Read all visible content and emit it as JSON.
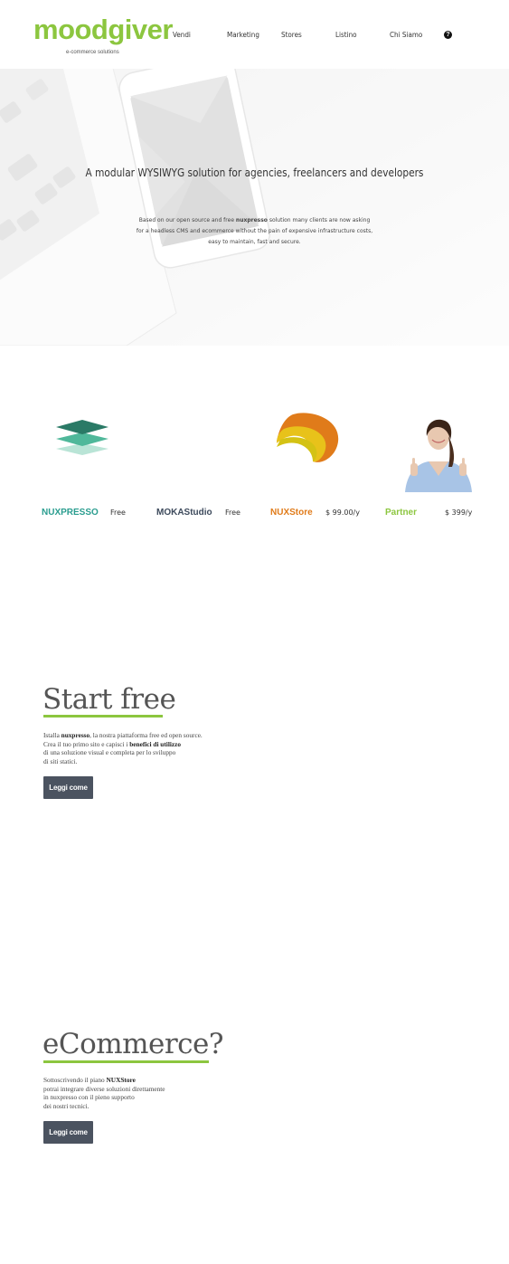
{
  "header": {
    "logo": "moodgiver",
    "tagline": "e-commerce solutions",
    "nav": [
      "Vendi",
      "Marketing",
      "Stores",
      "Listino",
      "Chi Siamo"
    ],
    "help_icon": "?"
  },
  "hero": {
    "title": "A modular WYSIWYG solution for agencies, freelancers and developers",
    "desc_1_pre": "Based on our open source and free ",
    "desc_1_link": "nuxpresso",
    "desc_1_post": " solution many clients are now asking",
    "desc_2": "for a headless CMS and ecommerce without the pain of expensive infrastructure costs,",
    "desc_3": "easy to maintain, fast and secure."
  },
  "products": [
    {
      "name": "NUXPRESSO",
      "price": "Free",
      "color": "#2a9d8f",
      "icon": "layers-icon"
    },
    {
      "name": "MOKAStudio",
      "price": "Free",
      "color": "#3d4a5c",
      "icon": ""
    },
    {
      "name": "NUXStore",
      "price": "$ 99.00/y",
      "color": "#e07b1a",
      "icon": "boomerang-icon"
    },
    {
      "name": "Partner",
      "price": "$ 399/y",
      "color": "#8cc63f",
      "icon": "partner-photo"
    }
  ],
  "start_free": {
    "title": "Start free",
    "l1_a": "Istalla ",
    "l1_b": "nuxpresso",
    "l1_c": ", la nostra piattaforma free ed open source.",
    "l2_a": "Crea il tuo primo sito e capisci i ",
    "l2_b": "benefici di utilizzo",
    "l3": "di una soluzione visual e completa per lo sviluppo",
    "l4": "di siti statici.",
    "button": "Leggi come"
  },
  "ecommerce": {
    "title": "eCommerce?",
    "l1_a": "Sottoscrivendo il piano ",
    "l1_b": "NUXStore",
    "l2": "potrai integrare diverse soluzioni direttamente",
    "l3": "in nuxpresso con il pieno supporto",
    "l4": "dei nostri tecnici.",
    "button": "Leggi come"
  },
  "colors": {
    "accent": "#8cc63f",
    "button": "#4b5360"
  }
}
